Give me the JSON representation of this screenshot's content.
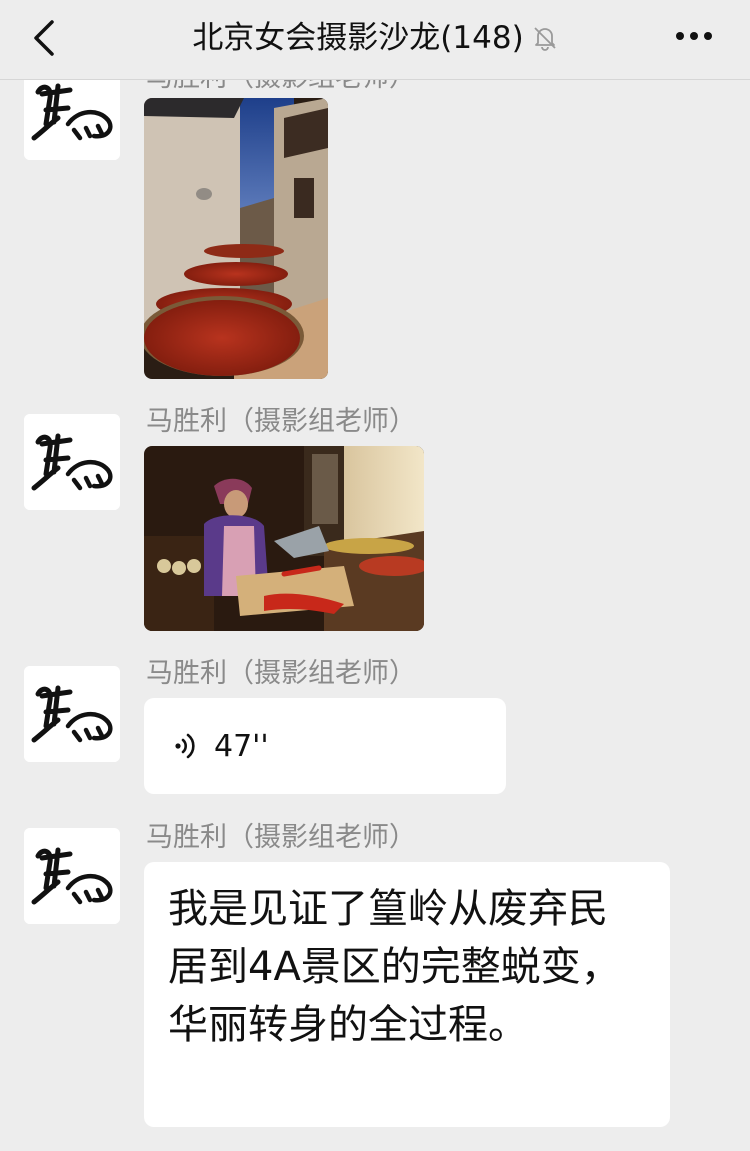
{
  "header": {
    "title": "北京女会摄影沙龙(148)",
    "back_icon": "chevron-left-icon",
    "mute_icon": "bell-slash-icon",
    "more_icon": "ellipsis-icon"
  },
  "messages": [
    {
      "sender": "马胜利（摄影组老师）",
      "type": "image",
      "image_desc_icon": "photo-drying-chilies"
    },
    {
      "sender": "马胜利（摄影组老师）",
      "type": "image",
      "image_desc_icon": "photo-woman-cutting-chilies"
    },
    {
      "sender": "马胜利（摄影组老师）",
      "type": "voice",
      "duration": "47''"
    },
    {
      "sender": "马胜利（摄影组老师）",
      "type": "text",
      "text": "我是见证了篁岭从废弃民居到4A景区的完整蜕变，华丽转身的全过程。"
    }
  ],
  "colors": {
    "background": "#ededed",
    "bubble": "#ffffff",
    "sender_text": "#8a8a8a"
  }
}
